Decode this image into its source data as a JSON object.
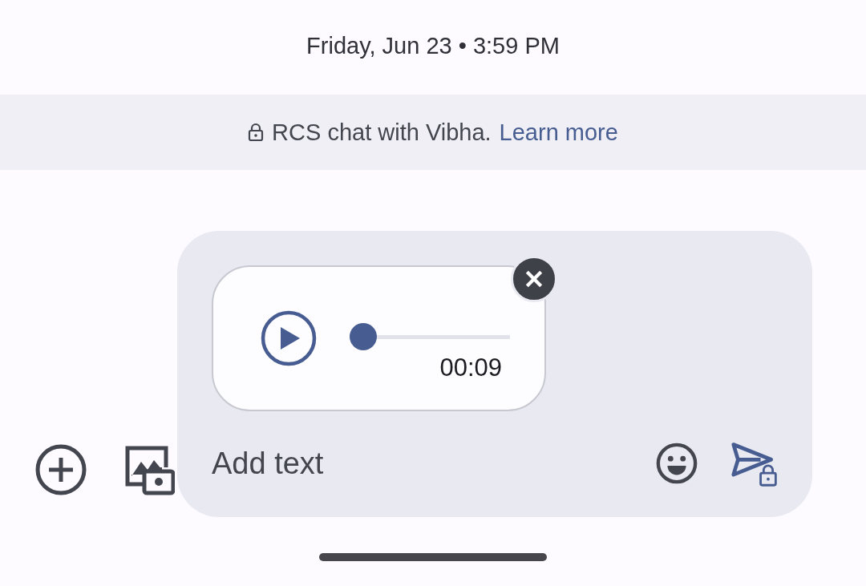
{
  "timestamp": "Friday, Jun 23 • 3:59 PM",
  "banner": {
    "text": "RCS chat with Vibha.",
    "link": "Learn more"
  },
  "attachment": {
    "kind": "audio",
    "level": 0,
    "duration": "00:09"
  },
  "composer": {
    "placeholder": "Add text"
  }
}
